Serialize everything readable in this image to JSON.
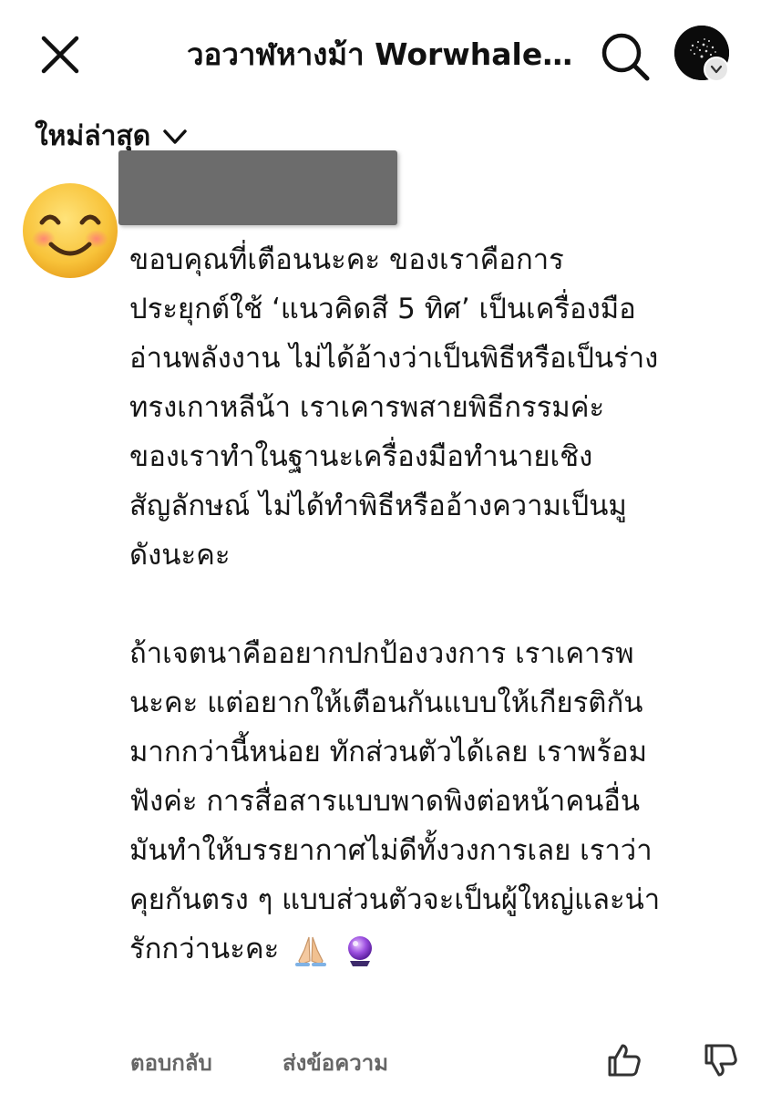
{
  "header": {
    "title": "วอวาฬหางม้า Worwhale Ponytail",
    "close_icon": "close-icon",
    "search_icon": "search-icon",
    "avatar_icon": "profile-avatar"
  },
  "sort": {
    "label": "ใหม่ล่าสุด",
    "icon": "chevron-down-icon"
  },
  "comment": {
    "author_avatar": "smiling-face-emoji",
    "author_name_redacted": true,
    "lines": [
      "ขอบคุณที่เตือนนะคะ ของเราคือการ",
      "ประยุกต์ใช้ ‘แนวคิดสี 5 ทิศ’ เป็นเครื่องมือ",
      "อ่านพลังงาน ไม่ได้อ้างว่าเป็นพิธีหรือเป็นร่าง",
      "ทรงเกาหลีน้า  เราเคารพสายพิธีกรรมค่ะ",
      "ของเราทำในฐานะเครื่องมือทำนายเชิง",
      "สัญลักษณ์ ไม่ได้ทำพิธีหรืออ้างความเป็นมู",
      "ดังนะคะ",
      "",
      "ถ้าเจตนาคืออยากปกป้องวงการ เราเคารพ",
      "นะคะ แต่อยากให้เตือนกันแบบให้เกียรติกัน",
      "มากกว่านี้หน่อย ทักส่วนตัวได้เลย เราพร้อม",
      "ฟังค่ะ การสื่อสารแบบพาดพิงต่อหน้าคนอื่น",
      "มันทำให้บรรยากาศไม่ดีทั้งวงการเลย เราว่า",
      "คุยกันตรง ๆ แบบส่วนตัวจะเป็นผู้ใหญ่และน่า",
      "รักกว่านะคะ"
    ],
    "trailing_emojis": [
      "folded-hands-emoji",
      "crystal-ball-emoji"
    ]
  },
  "actions": {
    "reply_label": "ตอบกลับ",
    "message_label": "ส่งข้อความ",
    "like_icon": "thumbs-up-icon",
    "dislike_icon": "thumbs-down-icon"
  }
}
